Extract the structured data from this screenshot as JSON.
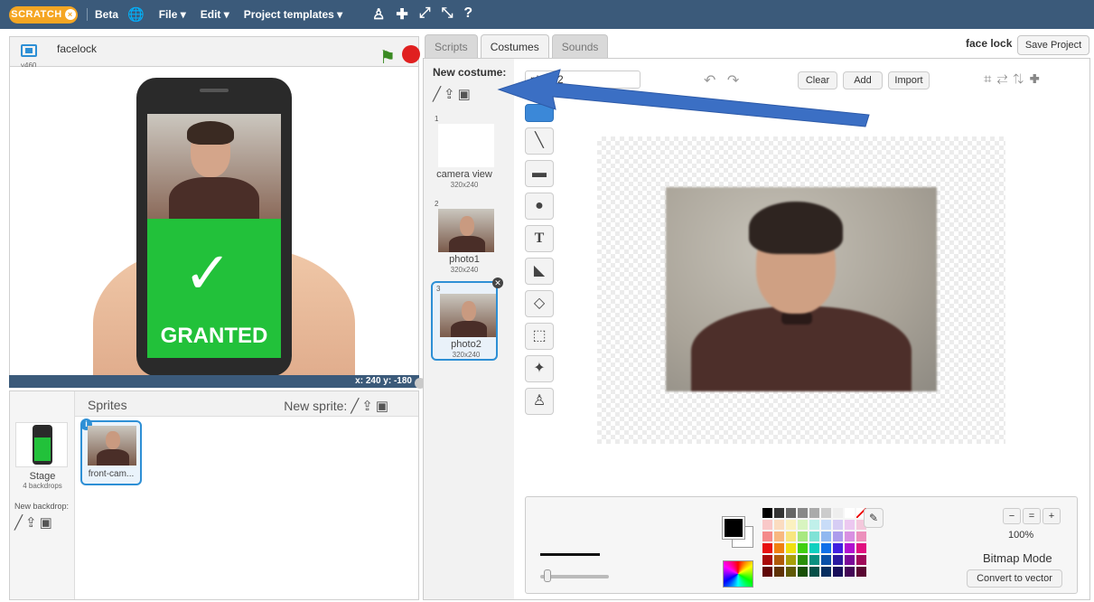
{
  "topbar": {
    "logo": "SCRATCH",
    "logo_badge": "×",
    "beta": "Beta",
    "globe_icon": "globe-icon",
    "menus": [
      "File ▾",
      "Edit ▾",
      "Project templates ▾"
    ],
    "tools": [
      "♙",
      "✚",
      "⤢",
      "⤡",
      "?"
    ]
  },
  "stage": {
    "version": "v460",
    "project_title": "facelock",
    "granted_text": "GRANTED",
    "check_mark": "✓",
    "coords": "x: 240   y: -180"
  },
  "sprites": {
    "label": "Sprites",
    "new_sprite_label": "New sprite:",
    "stage_label": "Stage",
    "stage_sub": "4 backdrops",
    "new_backdrop_label": "New backdrop:",
    "sprite_name": "front-cam...",
    "info_badge": "i"
  },
  "editor": {
    "tabs": [
      "Scripts",
      "Costumes",
      "Sounds"
    ],
    "active_tab": "Costumes",
    "sprite_title": "face lock",
    "save_button": "Save Project",
    "new_costume_label": "New costume:",
    "costumes": [
      {
        "num": "1",
        "name": "camera view",
        "size": "320x240"
      },
      {
        "num": "2",
        "name": "photo1",
        "size": "320x240"
      },
      {
        "num": "3",
        "name": "photo2",
        "size": "320x240"
      }
    ],
    "selected_costume": "3",
    "costume_name_value": "photo2",
    "buttons": {
      "clear": "Clear",
      "add": "Add",
      "import": "Import"
    },
    "zoom_level": "100%",
    "mode_label": "Bitmap Mode",
    "convert_button": "Convert to vector"
  },
  "colors": {
    "topbar": "#3b5a7a",
    "accent": "#2d8fd5",
    "granted_green": "#22c13a",
    "arrow": "#3b6fc4"
  }
}
